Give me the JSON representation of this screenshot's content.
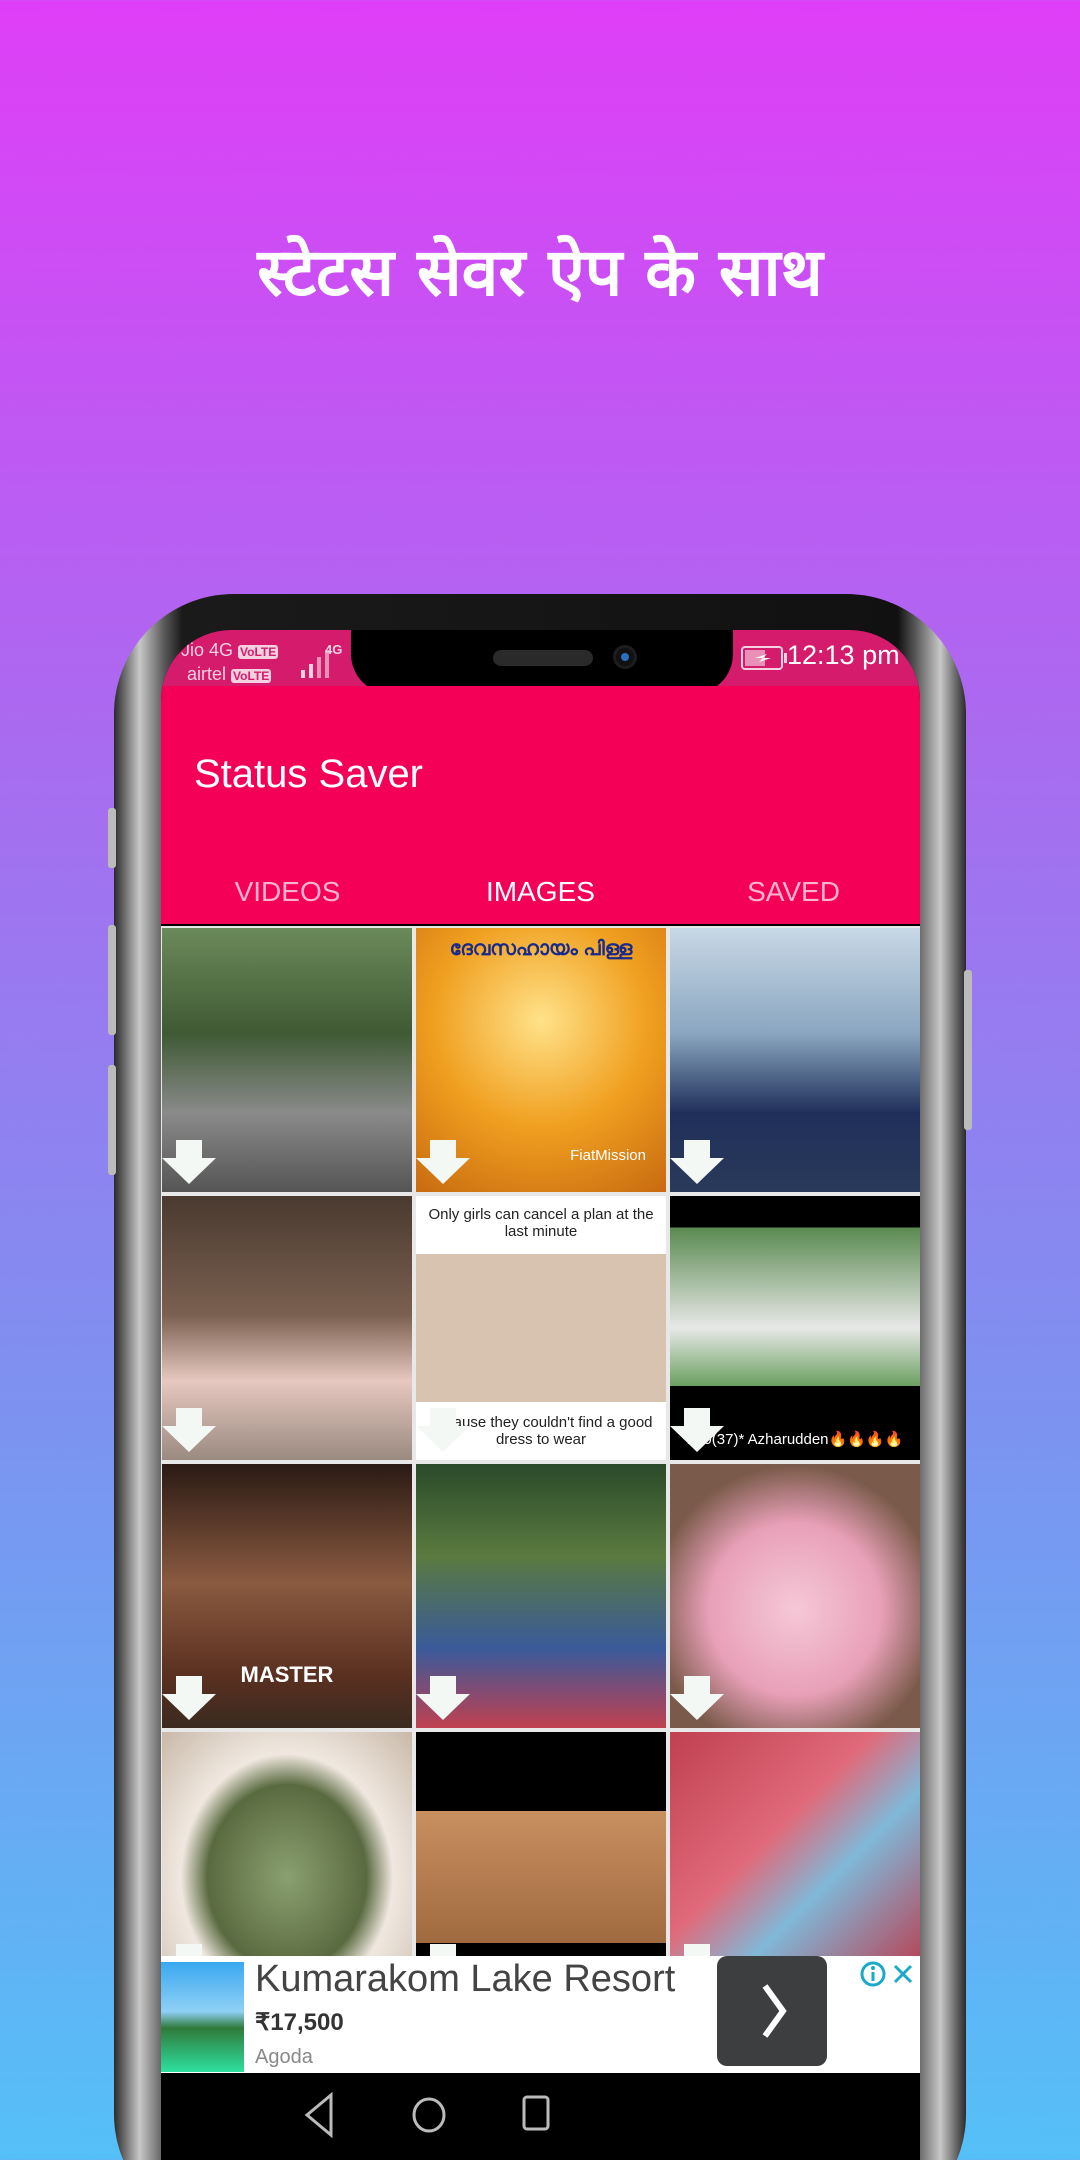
{
  "headline": "स्टेटस सेवर ऐप के साथ",
  "colors": {
    "accent": "#f50057",
    "status_bar": "#d41b6c",
    "indicator": "#e86fe0",
    "bg_top": "#df3ef7",
    "bg_bottom": "#55c0f7"
  },
  "status_bar": {
    "carrier1": "Jio 4G",
    "carrier1_badge": "VoLTE",
    "carrier2": "airtel",
    "carrier2_badge": "VoLTE",
    "network": "4G",
    "time": "12:13 pm",
    "battery_icon": "battery-charging-icon"
  },
  "app": {
    "title": "Status Saver",
    "tabs": [
      {
        "label": "VIDEOS",
        "active": false
      },
      {
        "label": "IMAGES",
        "active": true
      },
      {
        "label": "SAVED",
        "active": false
      }
    ]
  },
  "tiles": [
    {
      "bg": "linear-gradient(180deg,#6b8a5a,#3f5a34 40%,#8a8a8a 70%,#555)",
      "caption_top": "",
      "caption_bottom": ""
    },
    {
      "bg": "radial-gradient(circle at 50% 35%,#ffe28a,#f0a020 50%,#c86a10)",
      "caption_top": "ദേവസഹായം പിള്ള",
      "caption_bottom": "FiatMission"
    },
    {
      "bg": "linear-gradient(180deg,#c8d8e6,#8aa6c0 40%,#1f2f5a 70%,#2a3a5a)",
      "caption_top": "",
      "caption_bottom": ""
    },
    {
      "bg": "linear-gradient(180deg,#4a3a30,#7a6050 45%,#e6c8c0 70%,#9a8a80)",
      "caption_top": "",
      "caption_bottom": ""
    },
    {
      "bg": "linear-gradient(180deg,#fff 0 22%,#d8c2b0 22% 78%,#fff 78%)",
      "caption_top": "Only girls can cancel a plan at the last minute",
      "caption_bottom": "because they couldn't find a good dress to wear"
    },
    {
      "bg": "linear-gradient(180deg,#000 0 12%,#5a8a50 12%,#e8e8e8 50%,#6aa060 72%,#000 72%)",
      "caption_top": "",
      "caption_bottom": "100(37)* Azharudden🔥🔥🔥🔥"
    },
    {
      "bg": "linear-gradient(180deg,#2a1a14,#8a5a40 45%,#5a3020 80%,#3a2a20)",
      "caption_top": "",
      "caption_bottom": "MASTER"
    },
    {
      "bg": "linear-gradient(180deg,#2a4a2a,#5a7a40 35%,#3a5a9a 70%,#c04050)",
      "caption_top": "",
      "caption_bottom": ""
    },
    {
      "bg": "radial-gradient(circle at 50% 55%,#f5c8d8,#e8a0b8 45%,#7a5a4a 75%)",
      "caption_top": "",
      "caption_bottom": ""
    },
    {
      "bg": "radial-gradient(ellipse at 50% 55%,#8aa070,#5a6a40 45%,#f0e8e0 60%,#c8b8a8)",
      "caption_top": "",
      "caption_bottom": ""
    },
    {
      "bg": "linear-gradient(180deg,#000 0 30%,#c89060 30%,#a06a40 80%,#000 80%)",
      "caption_top": "",
      "caption_bottom": ""
    },
    {
      "bg": "linear-gradient(135deg,#c04050,#e06a7a 40%,#80b8d8 60%,#c03040)",
      "caption_top": "",
      "caption_bottom": ""
    }
  ],
  "ad": {
    "title": "Kumarakom Lake Resort",
    "price": "₹17,500",
    "source": "Agoda",
    "info_icon": "info-icon",
    "close_icon": "close-icon"
  },
  "nav": {
    "back": "back-icon",
    "home": "home-icon",
    "recents": "recents-icon"
  }
}
